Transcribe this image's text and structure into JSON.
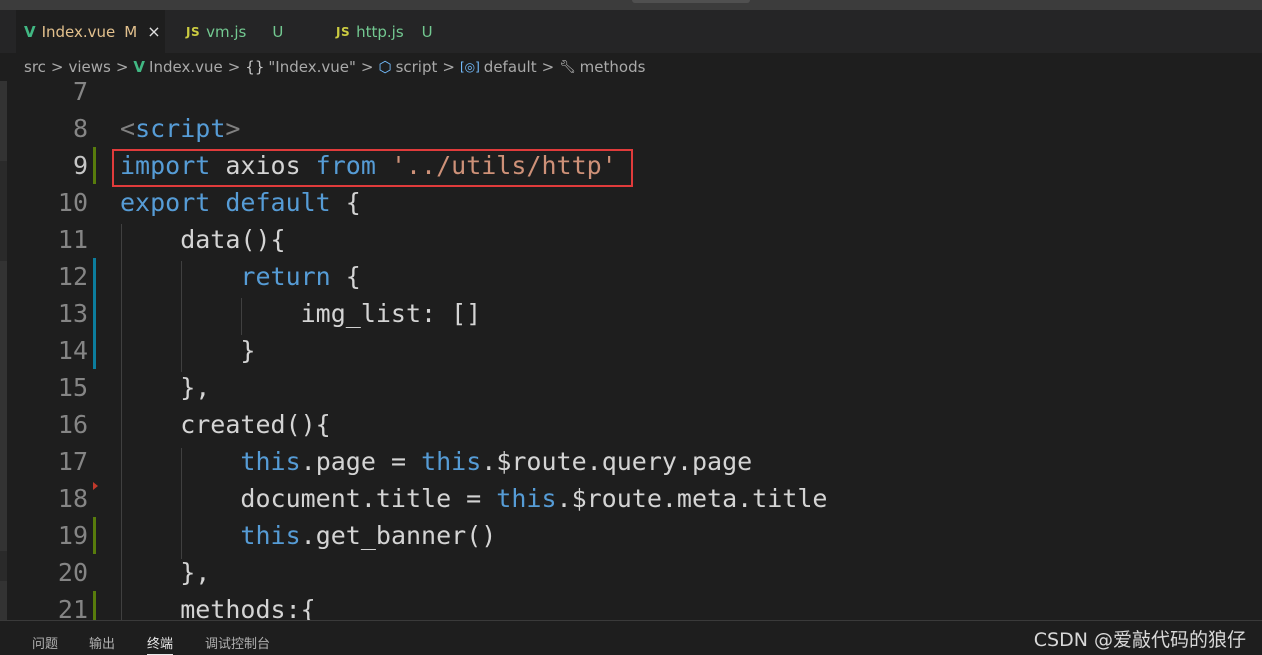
{
  "tabs": [
    {
      "name": "Index.vue",
      "status": "M",
      "icon": "vue-icon",
      "active": true,
      "has_close": true
    },
    {
      "name": "vm.js",
      "status": "U",
      "icon": "js-icon",
      "active": false
    },
    {
      "name": "http.js",
      "status": "U",
      "icon": "js-icon",
      "active": false
    }
  ],
  "tab_icons": {
    "vue": "V",
    "js": "JS",
    "close": "×"
  },
  "breadcrumb": {
    "items": [
      "src",
      "views",
      "Index.vue",
      "\"Index.vue\"",
      "script",
      "default",
      "methods"
    ],
    "icons": [
      "",
      "",
      "vue-icon",
      "braces-icon",
      "cube-icon",
      "module-icon",
      "wrench-icon"
    ],
    "icon_glyphs": {
      "vue": "V",
      "braces": "{}",
      "cube": "⬡",
      "module": "[◎]",
      "wrench": "🔧"
    },
    "separator": ">"
  },
  "editor": {
    "lines": [
      {
        "num": "7",
        "tokens": []
      },
      {
        "num": "8",
        "tokens": [
          [
            "t",
            "<"
          ],
          [
            "k",
            "script"
          ],
          [
            "t",
            ">"
          ]
        ]
      },
      {
        "num": "9",
        "tokens": [
          [
            "k",
            "import"
          ],
          [
            "p",
            " axios "
          ],
          [
            "k",
            "from"
          ],
          [
            "p",
            " "
          ],
          [
            "s",
            "'../utils/http'"
          ]
        ]
      },
      {
        "num": "10",
        "tokens": [
          [
            "k",
            "export"
          ],
          [
            "p",
            " "
          ],
          [
            "k",
            "default"
          ],
          [
            "p",
            " {"
          ]
        ]
      },
      {
        "num": "11",
        "tokens": [
          [
            "p",
            "    data(){"
          ]
        ]
      },
      {
        "num": "12",
        "tokens": [
          [
            "p",
            "        "
          ],
          [
            "k",
            "return"
          ],
          [
            "p",
            " {"
          ]
        ]
      },
      {
        "num": "13",
        "tokens": [
          [
            "p",
            "            img_list: []"
          ]
        ]
      },
      {
        "num": "14",
        "tokens": [
          [
            "p",
            "        }"
          ]
        ]
      },
      {
        "num": "15",
        "tokens": [
          [
            "p",
            "    },"
          ]
        ]
      },
      {
        "num": "16",
        "tokens": [
          [
            "p",
            "    created(){"
          ]
        ]
      },
      {
        "num": "17",
        "tokens": [
          [
            "p",
            "        "
          ],
          [
            "k",
            "this"
          ],
          [
            "p",
            ".page = "
          ],
          [
            "k",
            "this"
          ],
          [
            "p",
            ".$route.query.page"
          ]
        ]
      },
      {
        "num": "18",
        "tokens": [
          [
            "p",
            "        document.title = "
          ],
          [
            "k",
            "this"
          ],
          [
            "p",
            ".$route.meta.title"
          ]
        ]
      },
      {
        "num": "19",
        "tokens": [
          [
            "p",
            "        "
          ],
          [
            "k",
            "this"
          ],
          [
            "p",
            ".get_banner()"
          ]
        ]
      },
      {
        "num": "20",
        "tokens": [
          [
            "p",
            "    },"
          ]
        ]
      },
      {
        "num": "21",
        "tokens": [
          [
            "p",
            "    methods:{"
          ]
        ]
      }
    ],
    "current_line": "9",
    "highlight_line": "9",
    "git_markers": {
      "9": "added",
      "12": "modified",
      "13": "modified",
      "14": "modified",
      "19": "added",
      "21": "added"
    }
  },
  "colors": {
    "keyword": "#569cd6",
    "string": "#ce9178",
    "text": "#d4d4d4",
    "tag_bracket": "#808080",
    "added": "#587c0c",
    "modified": "#0c7d9d",
    "highlight_box": "#e03b3b",
    "tab_modified": "#e2c08d",
    "tab_untracked": "#73c991"
  },
  "panel": {
    "tabs": [
      "问题",
      "输出",
      "终端",
      "调试控制台"
    ],
    "active": "终端"
  },
  "watermark": "CSDN @爱敲代码的狼仔"
}
